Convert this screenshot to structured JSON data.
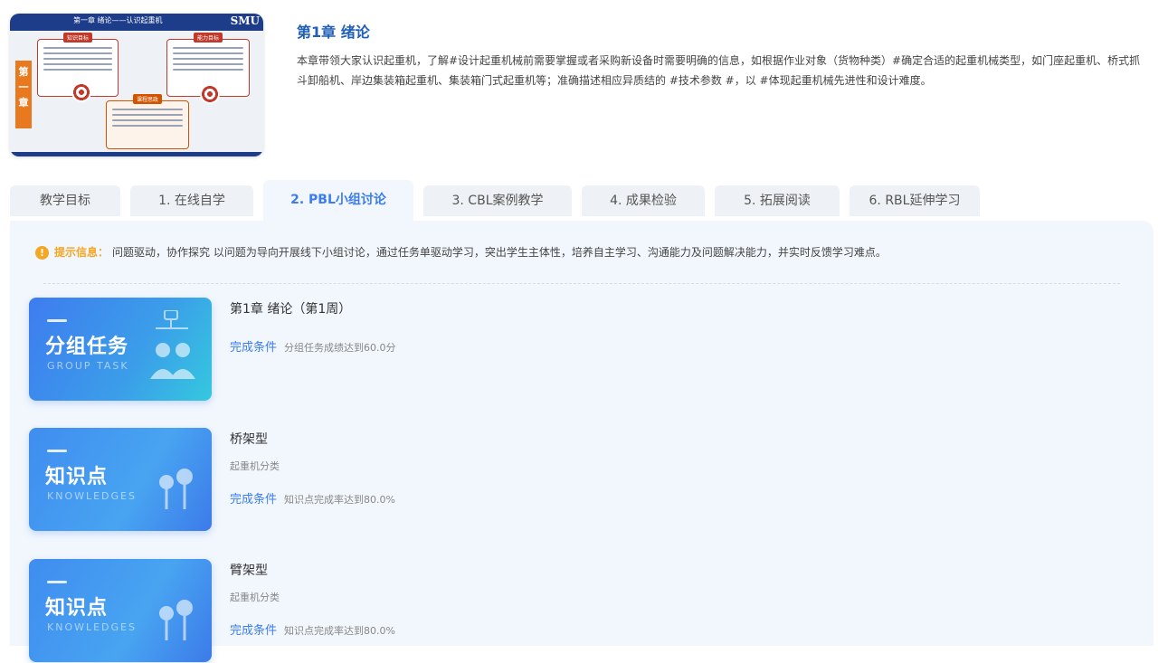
{
  "thumbnail": {
    "title": "第一章 绪论——认识起重机",
    "logo": "SMU",
    "side_label": "第一章",
    "box_captions": [
      "知识目标",
      "能力目标",
      "课程思政"
    ]
  },
  "chapter": {
    "title": "第1章 绪论",
    "description": "本章带领大家认识起重机，了解#设计起重机械前需要掌握或者采购新设备时需要明确的信息，如根据作业对象（货物种类）#确定合适的起重机械类型，如门座起重机、桥式抓斗卸船机、岸边集装箱起重机、集装箱门式起重机等；准确描述相应异质结的 #技术参数 #，以 #体现起重机械先进性和设计难度。"
  },
  "tabs": [
    {
      "label": "教学目标"
    },
    {
      "label": "1. 在线自学"
    },
    {
      "label": "2. PBL小组讨论"
    },
    {
      "label": "3. CBL案例教学"
    },
    {
      "label": "4. 成果检验"
    },
    {
      "label": "5. 拓展阅读"
    },
    {
      "label": "6. RBL延伸学习"
    }
  ],
  "active_tab": "2. PBL小组讨论",
  "tip": {
    "icon": "exclamation-icon",
    "label": "提示信息：",
    "text": "问题驱动，协作探究 以问题为导向开展线下小组讨论，通过任务单驱动学习，突出学生主体性，培养自主学习、沟通能力及问题解决能力，并实时反馈学习难点。"
  },
  "tasks": [
    {
      "banner_cn": "分组任务",
      "banner_en": "GROUP TASK",
      "title": "第1章 绪论（第1周）",
      "subtitle": "",
      "cond_label": "完成条件",
      "cond_value": "分组任务成绩达到60.0分"
    },
    {
      "banner_cn": "知识点",
      "banner_en": "KNOWLEDGES",
      "title": "桥架型",
      "subtitle": "起重机分类",
      "cond_label": "完成条件",
      "cond_value": "知识点完成率达到80.0%"
    },
    {
      "banner_cn": "知识点",
      "banner_en": "KNOWLEDGES",
      "title": "臂架型",
      "subtitle": "起重机分类",
      "cond_label": "完成条件",
      "cond_value": "知识点完成率达到80.0%"
    }
  ],
  "colors": {
    "accent": "#3b7cf3",
    "title_blue": "#1f5fb8",
    "tip_orange": "#f5a623",
    "panel_bg": "#f2f7fd"
  }
}
